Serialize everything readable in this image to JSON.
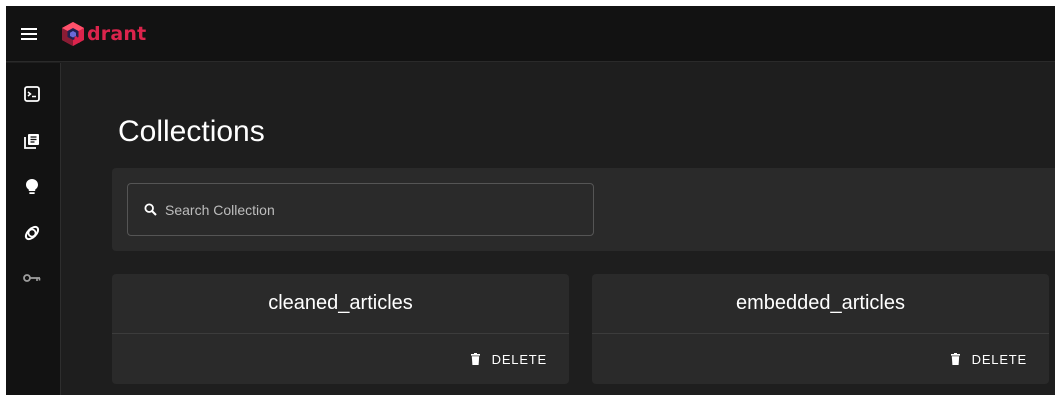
{
  "app": {
    "logo_text": "drant",
    "brand_color": "#dc244c"
  },
  "topbar": {
    "menu_icon": "hamburger-menu-icon"
  },
  "sidebar": {
    "items": [
      {
        "icon": "console-icon"
      },
      {
        "icon": "collections-icon"
      },
      {
        "icon": "lightbulb-icon"
      },
      {
        "icon": "rings-icon"
      },
      {
        "icon": "key-icon"
      }
    ]
  },
  "main": {
    "title": "Collections",
    "search": {
      "placeholder": "Search Collection",
      "value": ""
    },
    "collections": [
      {
        "name": "cleaned_articles",
        "delete_label": "DELETE"
      },
      {
        "name": "embedded_articles",
        "delete_label": "DELETE"
      }
    ]
  }
}
